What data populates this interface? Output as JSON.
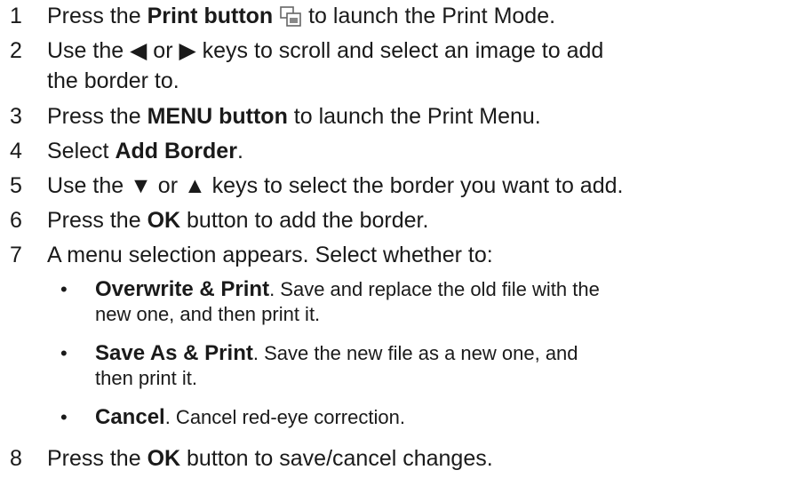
{
  "steps": [
    {
      "num": "1",
      "pre": "Press the ",
      "bold": "Print button",
      "post": " to launch the Print Mode.",
      "icon": "print-icon"
    },
    {
      "num": "2",
      "pre": "Use the ",
      "left_key": "◀",
      "mid": " or ",
      "right_key": "▶",
      "post": " keys to scroll and select an image to add",
      "line2": "the border to."
    },
    {
      "num": "3",
      "pre": "Press the ",
      "bold": "MENU button",
      "post": " to launch the Print Menu."
    },
    {
      "num": "4",
      "pre": "Select ",
      "bold": "Add Border",
      "post": "."
    },
    {
      "num": "5",
      "pre": "Use the ",
      "down_key": "▼",
      "mid": " or ",
      "up_key": "▲",
      "post": " keys to select the border you want to add."
    },
    {
      "num": "6",
      "pre": "Press the ",
      "bold": "OK",
      "post": " button to add the border."
    },
    {
      "num": "7",
      "text": "A menu selection appears. Select whether to:"
    },
    {
      "num": "8",
      "pre": "Press the ",
      "bold": "OK",
      "post": " button to save/cancel changes."
    }
  ],
  "options": [
    {
      "bullet": "•",
      "bold": "Overwrite & Print",
      "post": ". Save and replace the old file with the",
      "line2": "new one, and then print it."
    },
    {
      "bullet": "•",
      "bold": "Save As & Print",
      "post": ". Save the new file as a new one, and",
      "line2": "then print it."
    },
    {
      "bullet": "•",
      "bold": "Cancel",
      "post": ". Cancel red-eye correction."
    }
  ]
}
